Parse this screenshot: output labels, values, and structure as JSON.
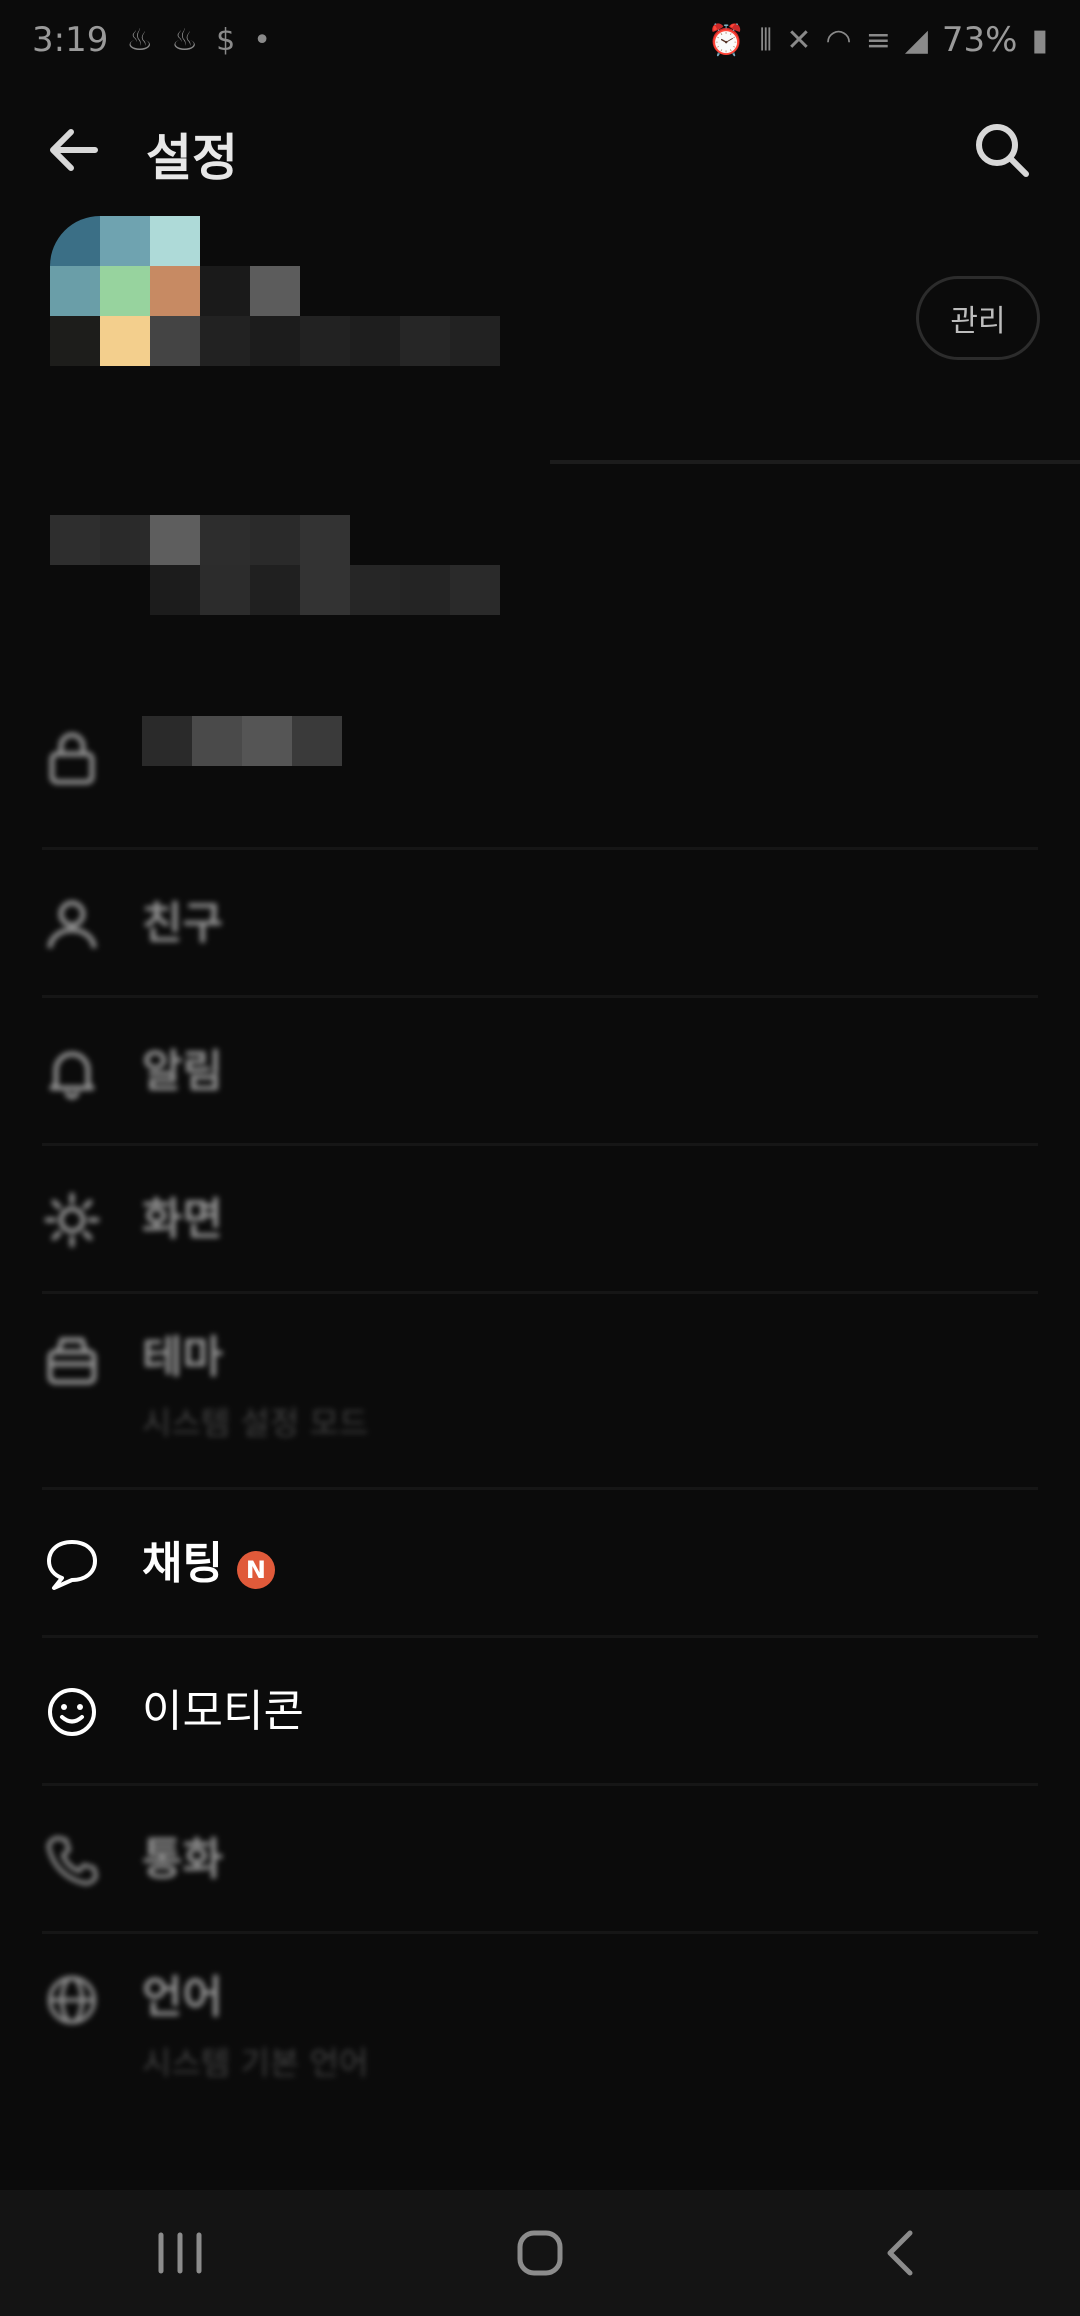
{
  "status_bar": {
    "time": "3:19",
    "battery": "73%",
    "icons": [
      "fire-icon",
      "fire-icon",
      "dollar-icon",
      "dot-icon",
      "alarm-icon",
      "vibrate-icon",
      "mute-icon",
      "wifi-icon",
      "lte-icon",
      "signal-icon",
      "battery-icon"
    ]
  },
  "header": {
    "title": "설정",
    "back_icon": "arrow-left-icon",
    "search_icon": "search-icon"
  },
  "profile": {
    "manage_label": "관리"
  },
  "menu": [
    {
      "id": "privacy",
      "label": "",
      "icon": "lock-icon",
      "blurred": true
    },
    {
      "id": "friends",
      "label": "친구",
      "icon": "person-icon",
      "blurred": true
    },
    {
      "id": "notifications",
      "label": "알림",
      "icon": "bell-icon",
      "blurred": true
    },
    {
      "id": "display",
      "label": "화면",
      "icon": "brightness-icon",
      "blurred": true
    },
    {
      "id": "theme",
      "label": "테마",
      "sub": "시스템 설정 모드",
      "icon": "theme-icon",
      "blurred": true
    },
    {
      "id": "chat",
      "label": "채팅",
      "badge": "N",
      "icon": "chat-bubble-icon",
      "blurred": false
    },
    {
      "id": "emoticon",
      "label": "이모티콘",
      "icon": "smiley-icon",
      "blurred": false
    },
    {
      "id": "call",
      "label": "통화",
      "icon": "phone-icon",
      "blurred": true
    },
    {
      "id": "language",
      "label": "언어",
      "sub": "시스템 기본 언어",
      "icon": "globe-icon",
      "blurred": true
    }
  ],
  "colors": {
    "background": "#0b0b0b",
    "badge": "#e05a3a",
    "nav_bar": "#141414"
  },
  "nav_bar": {
    "icons": [
      "recent-apps-icon",
      "home-icon",
      "back-icon"
    ]
  }
}
